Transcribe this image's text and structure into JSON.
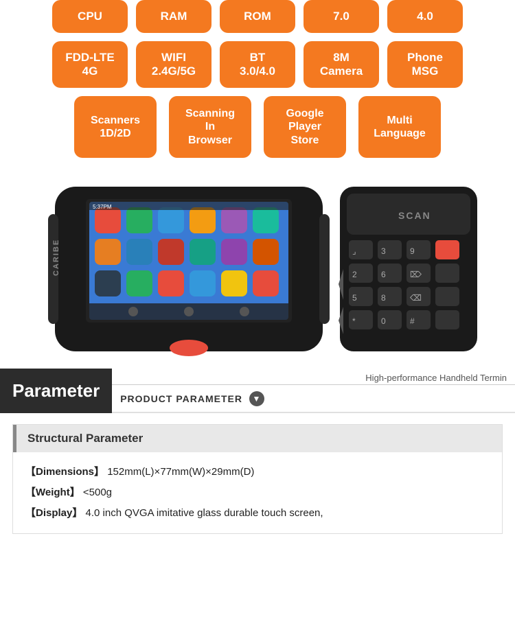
{
  "badges": {
    "row1": [
      {
        "label": "CPU"
      },
      {
        "label": "RAM"
      },
      {
        "label": "ROM"
      },
      {
        "label": "7.0"
      },
      {
        "label": "4.0"
      }
    ],
    "row2": [
      {
        "label": "FDD-LTE\n4G"
      },
      {
        "label": "WIFI\n2.4G/5G"
      },
      {
        "label": "BT\n3.0/4.0"
      },
      {
        "label": "8M\nCamera"
      },
      {
        "label": "Phone\nMSG"
      }
    ],
    "row3": [
      {
        "label": "Scanners\n1D/2D"
      },
      {
        "label": "Scanning\nIn\nBrowser"
      },
      {
        "label": "Google\nPlayer\nStore"
      },
      {
        "label": "Multi\nLanguage"
      }
    ]
  },
  "parameter": {
    "label": "Parameter",
    "tagline": "High-performance Handheld Termin",
    "product_label": "PRODUCT PARAMETER"
  },
  "structural": {
    "header": "Structural Parameter",
    "fields": [
      {
        "label": "【Dimensions】",
        "value": "152mm(L)×77mm(W)×29mm(D)"
      },
      {
        "label": "【Weight】",
        "value": "<500g"
      },
      {
        "label": "【Display】",
        "value": "4.0 inch QVGA imitative glass durable touch screen,"
      }
    ]
  }
}
